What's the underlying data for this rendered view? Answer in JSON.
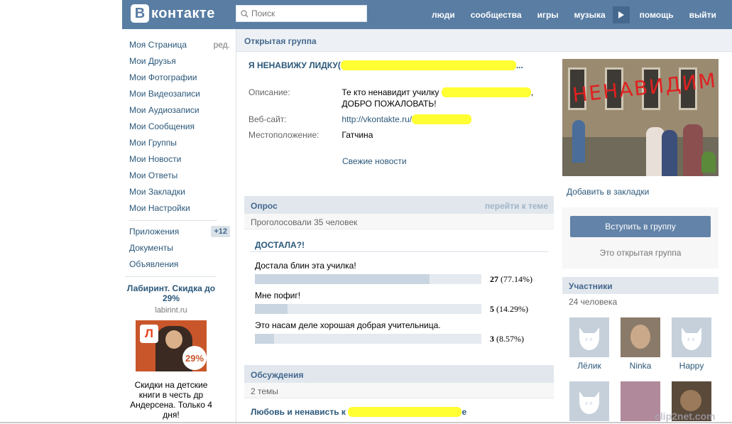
{
  "header": {
    "logo_letter": "В",
    "logo_text": "контакте",
    "search_placeholder": "Поиск",
    "nav": [
      "люди",
      "сообщества",
      "игры",
      "музыка",
      "помощь",
      "выйти"
    ]
  },
  "sidebar": {
    "edit_label": "ред.",
    "items": [
      "Моя Страница",
      "Мои Друзья",
      "Мои Фотографии",
      "Мои Видеозаписи",
      "Мои Аудиозаписи",
      "Мои Сообщения",
      "Мои Группы",
      "Мои Новости",
      "Мои Ответы",
      "Мои Закладки",
      "Мои Настройки"
    ],
    "extra": [
      "Приложения",
      "Документы",
      "Объявления"
    ],
    "apps_badge": "+12"
  },
  "ad": {
    "title": "Лабиринт. Скидка до 29%",
    "site": "labirint.ru",
    "logo_letter": "Л",
    "discount": "29%",
    "text": "Скидки на детские книги в честь др Андерсена. Только 4 дня!"
  },
  "group": {
    "type_label": "Открытая группа",
    "name": "Я НЕНАВИЖУ ЛИДКУ(",
    "name_suffix": "...",
    "info": {
      "desc_label": "Описание:",
      "desc_value_1": "Те кто ненавидит училку",
      "desc_value_2": "ДОБРО ПОЖАЛОВАТЬ!",
      "site_label": "Веб-сайт:",
      "site_value": "http://vkontakte.ru/",
      "loc_label": "Местоположение:",
      "loc_value": "Гатчина"
    },
    "fresh_news": "Свежие новости"
  },
  "poll": {
    "header": "Опрос",
    "goto": "перейти к теме",
    "voted": "Проголосовали 35 человек",
    "question": "ДОСТАЛА?!",
    "answers": [
      {
        "label": "Достала блин эта училка!",
        "count": "27",
        "pct": "(77.14%)",
        "value": 77.14
      },
      {
        "label": "Мне пофиг!",
        "count": "5",
        "pct": "(14.29%)",
        "value": 14.29
      },
      {
        "label": "Это насам деле хорошая добрая учительница.",
        "count": "3",
        "pct": "(8.57%)",
        "value": 8.57
      }
    ]
  },
  "discussions": {
    "header": "Обсуждения",
    "count": "2 темы",
    "topic": "Любовь и ненависть к",
    "topic_end": "е"
  },
  "photo": {
    "overlay_text": "НЕНАВИДИМ"
  },
  "right": {
    "bookmark": "Добавить в закладки",
    "join": "Вступить в группу",
    "open_group": "Это открытая группа",
    "members_header": "Участники",
    "members_count": "24 человека",
    "members": [
      "Лёлик",
      "Ninka",
      "Happy"
    ]
  },
  "watermark": "clip2net.com",
  "colors": {
    "header": "#597da3",
    "link": "#2b587a",
    "highlight": "#ffff33"
  }
}
